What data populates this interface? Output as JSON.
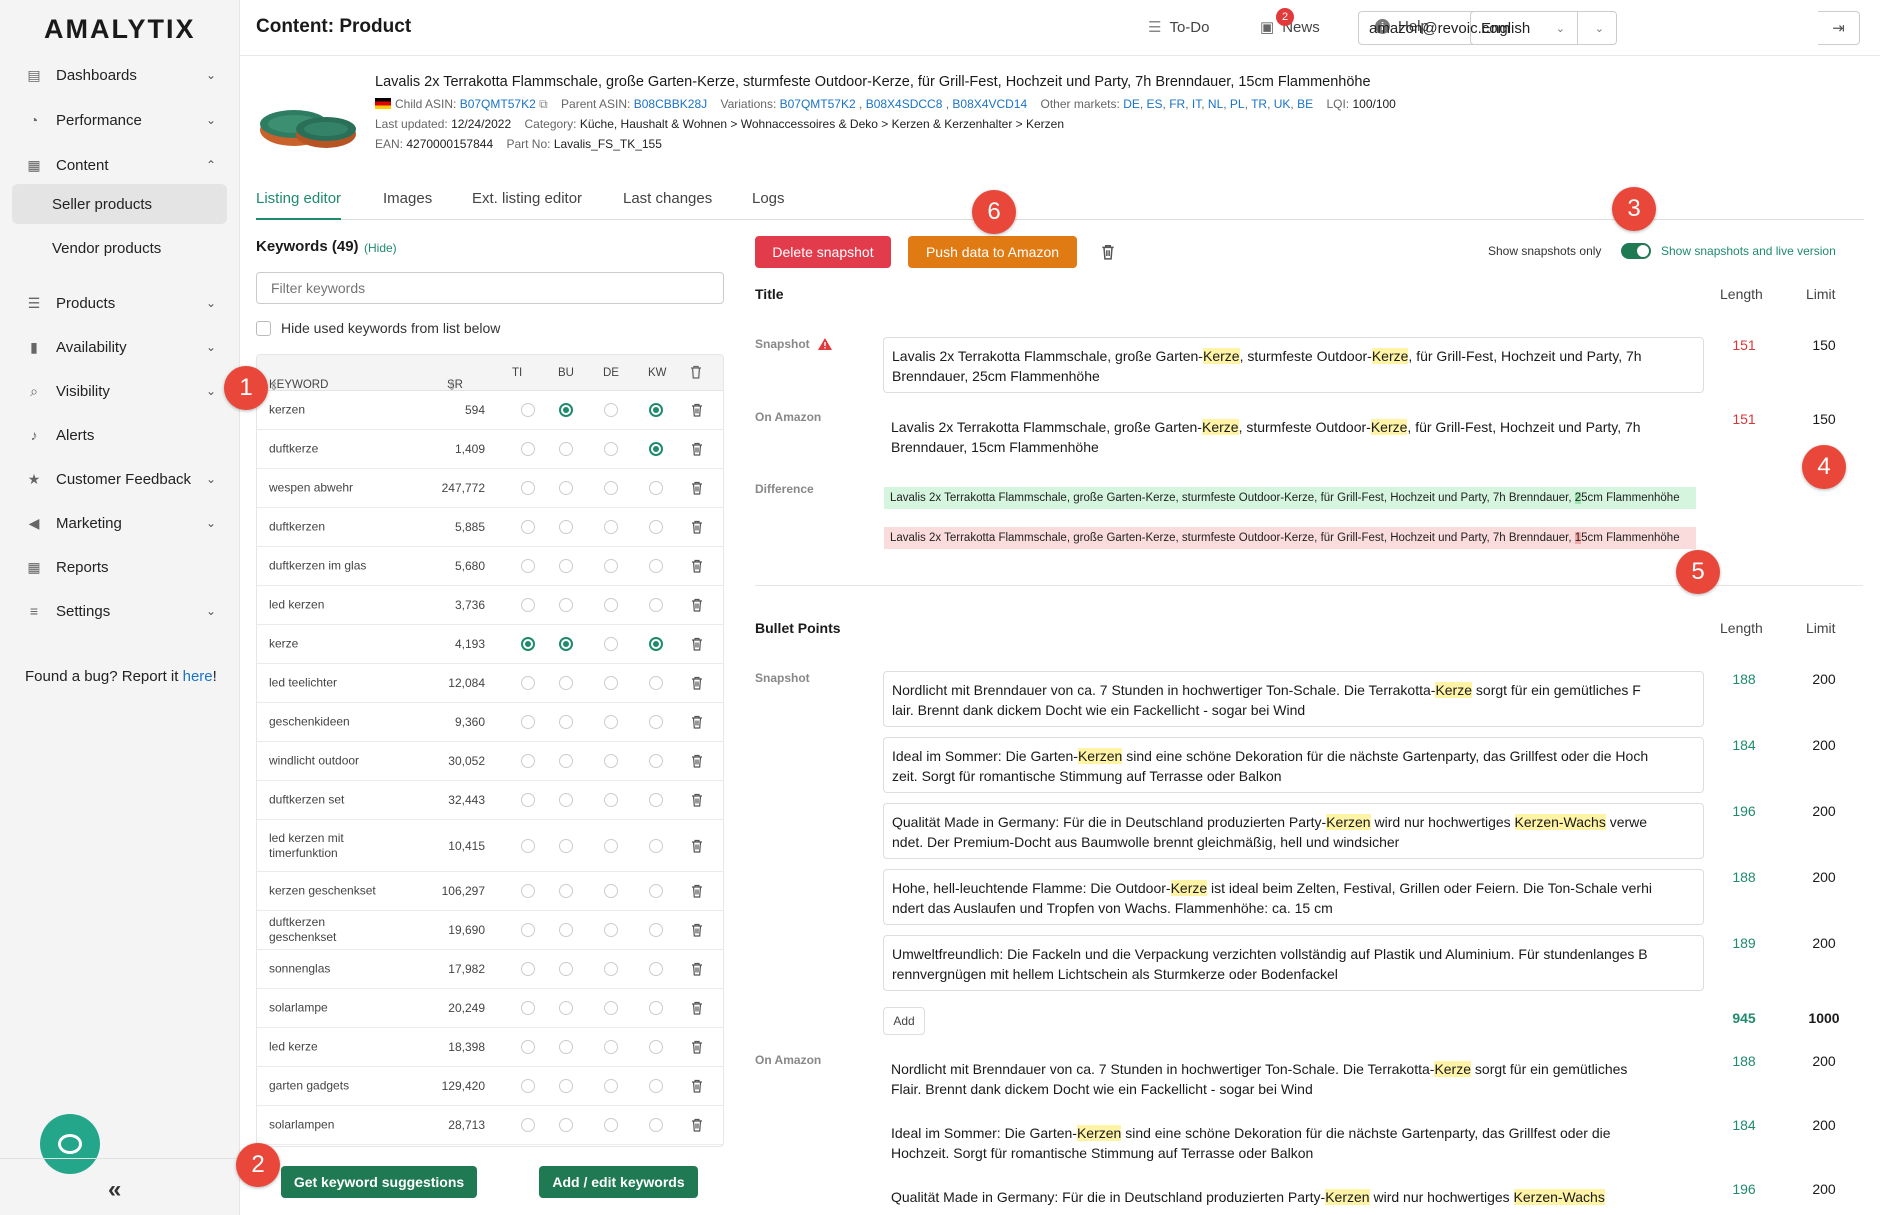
{
  "app": {
    "logo": "AMALYTIX"
  },
  "sidebar": {
    "items": [
      {
        "label": "Dashboards",
        "icon": "dashboard-icon"
      },
      {
        "label": "Performance",
        "icon": "gauge-icon"
      },
      {
        "label": "Content",
        "icon": "content-icon"
      },
      {
        "label": "Products",
        "icon": "list-icon"
      },
      {
        "label": "Availability",
        "icon": "thermometer-icon"
      },
      {
        "label": "Visibility",
        "icon": "search-icon"
      },
      {
        "label": "Alerts",
        "icon": "bell-icon"
      },
      {
        "label": "Customer Feedback",
        "icon": "star-icon"
      },
      {
        "label": "Marketing",
        "icon": "megaphone-icon"
      },
      {
        "label": "Reports",
        "icon": "table-icon"
      },
      {
        "label": "Settings",
        "icon": "sliders-icon"
      }
    ],
    "sub_items": [
      "Seller products",
      "Vendor products"
    ],
    "bug_text": "Found a bug? Report it ",
    "bug_link": "here",
    "bug_end": "!"
  },
  "topbar": {
    "title": "Content: Product",
    "todo": "To-Do",
    "news": "News",
    "news_count": "2",
    "help": "Help",
    "language": "English",
    "account": "amazon@revoic.com"
  },
  "product": {
    "title": "Lavalis 2x Terrakotta Flammschale, große Garten-Kerze, sturmfeste Outdoor-Kerze, für Grill-Fest, Hochzeit und Party, 7h Brenndauer, 15cm Flammenhöhe",
    "child_asin_label": "Child ASIN:",
    "child_asin": "B07QMT57K2",
    "parent_asin_label": "Parent ASIN:",
    "parent_asin": "B08CBBK28J",
    "variations_label": "Variations:",
    "variations": [
      "B07QMT57K2",
      "B08X4SDCC8",
      "B08X4VCD14"
    ],
    "other_markets_label": "Other markets:",
    "other_markets": [
      "DE",
      "ES",
      "FR",
      "IT",
      "NL",
      "PL",
      "TR",
      "UK",
      "BE"
    ],
    "lqi_label": "LQI:",
    "lqi": "100/100",
    "last_updated_label": "Last updated:",
    "last_updated": "12/24/2022",
    "category_label": "Category:",
    "category": "Küche, Haushalt & Wohnen > Wohnaccessoires & Deko > Kerzen & Kerzenhalter > Kerzen",
    "ean_label": "EAN:",
    "ean": "4270000157844",
    "partno_label": "Part No:",
    "partno": "Lavalis_FS_TK_155"
  },
  "tabs": [
    "Listing editor",
    "Images",
    "Ext. listing editor",
    "Last changes",
    "Logs"
  ],
  "keywords": {
    "heading": "Keywords (49)",
    "hide": "(Hide)",
    "filter_placeholder": "Filter keywords",
    "hide_used_label": "Hide used keywords from list below",
    "columns": [
      "KEYWORD",
      "SR",
      "TI",
      "BU",
      "DE",
      "KW"
    ],
    "rows": [
      {
        "k": "kerzen",
        "sr": "594",
        "ti": false,
        "bu": true,
        "de": false,
        "kw": true
      },
      {
        "k": "duftkerze",
        "sr": "1,409",
        "ti": false,
        "bu": false,
        "de": false,
        "kw": true
      },
      {
        "k": "wespen abwehr",
        "sr": "247,772",
        "ti": false,
        "bu": false,
        "de": false,
        "kw": false
      },
      {
        "k": "duftkerzen",
        "sr": "5,885",
        "ti": false,
        "bu": false,
        "de": false,
        "kw": false
      },
      {
        "k": "duftkerzen im glas",
        "sr": "5,680",
        "ti": false,
        "bu": false,
        "de": false,
        "kw": false
      },
      {
        "k": "led kerzen",
        "sr": "3,736",
        "ti": false,
        "bu": false,
        "de": false,
        "kw": false
      },
      {
        "k": "kerze",
        "sr": "4,193",
        "ti": true,
        "bu": true,
        "de": false,
        "kw": true
      },
      {
        "k": "led teelichter",
        "sr": "12,084",
        "ti": false,
        "bu": false,
        "de": false,
        "kw": false
      },
      {
        "k": "geschenkideen",
        "sr": "9,360",
        "ti": false,
        "bu": false,
        "de": false,
        "kw": false
      },
      {
        "k": "windlicht outdoor",
        "sr": "30,052",
        "ti": false,
        "bu": false,
        "de": false,
        "kw": false
      },
      {
        "k": "duftkerzen set",
        "sr": "32,443",
        "ti": false,
        "bu": false,
        "de": false,
        "kw": false
      },
      {
        "k": "led kerzen mit timerfunktion",
        "sr": "10,415",
        "ti": false,
        "bu": false,
        "de": false,
        "kw": false
      },
      {
        "k": "kerzen geschenkset",
        "sr": "106,297",
        "ti": false,
        "bu": false,
        "de": false,
        "kw": false
      },
      {
        "k": "duftkerzen geschenkset",
        "sr": "19,690",
        "ti": false,
        "bu": false,
        "de": false,
        "kw": false
      },
      {
        "k": "sonnenglas",
        "sr": "17,982",
        "ti": false,
        "bu": false,
        "de": false,
        "kw": false
      },
      {
        "k": "solarlampe",
        "sr": "20,249",
        "ti": false,
        "bu": false,
        "de": false,
        "kw": false
      },
      {
        "k": "led kerze",
        "sr": "18,398",
        "ti": false,
        "bu": false,
        "de": false,
        "kw": false
      },
      {
        "k": "garten gadgets",
        "sr": "129,420",
        "ti": false,
        "bu": false,
        "de": false,
        "kw": false
      },
      {
        "k": "solarlampen",
        "sr": "28,713",
        "ti": false,
        "bu": false,
        "de": false,
        "kw": false
      }
    ],
    "suggest_button": "Get keyword suggestions",
    "edit_button": "Add / edit keywords"
  },
  "actions": {
    "delete_snapshot": "Delete snapshot",
    "push_data": "Push data to Amazon",
    "toggle_left": "Show snapshots only",
    "toggle_right": "Show snapshots and live version"
  },
  "title_section": {
    "heading": "Title",
    "length_label": "Length",
    "limit_label": "Limit",
    "snapshot_label": "Snapshot",
    "on_amazon_label": "On Amazon",
    "difference_label": "Difference",
    "snapshot_pre": "Lavalis 2x Terrakotta Flammschale, große Garten-",
    "snapshot_mid": ", sturmfeste Outdoor-",
    "snapshot_post": ", für Grill-Fest, Hochzeit und Party, 7h Brenndauer, 25cm Flammenhöhe",
    "amazon_post": ", für Grill-Fest, Hochzeit und Party, 7h Brenndauer, 15cm Flammenhöhe",
    "kw": "Kerze",
    "snapshot_length": "151",
    "snapshot_limit": "150",
    "amazon_length": "151",
    "amazon_limit": "150",
    "diff_pre": "Lavalis 2x Terrakotta Flammschale, große Garten-Kerze, sturmfeste Outdoor-Kerze, für Grill-Fest, Hochzeit und Party, 7h Brenndauer, ",
    "diff_green_char": "2",
    "diff_red_char": "1",
    "diff_post": "5cm Flammenhöhe"
  },
  "bullets": {
    "heading": "Bullet Points",
    "length_label": "Length",
    "limit_label": "Limit",
    "snapshot_label": "Snapshot",
    "on_amazon_label": "On Amazon",
    "add_label": "Add",
    "total_length": "945",
    "total_limit": "1000",
    "snapshot": [
      {
        "length": "188",
        "limit": "200"
      },
      {
        "length": "184",
        "limit": "200"
      },
      {
        "length": "196",
        "limit": "200"
      },
      {
        "length": "188",
        "limit": "200"
      },
      {
        "length": "189",
        "limit": "200"
      }
    ],
    "amazon": [
      {
        "length": "188",
        "limit": "200"
      },
      {
        "length": "184",
        "limit": "200"
      },
      {
        "length": "196",
        "limit": "200"
      }
    ],
    "b1_pre": "Nordlicht mit Brenndauer von ca. 7 Stunden in hochwertiger Ton-Schale. Die Terrakotta-",
    "b1_kw": "Kerze",
    "b1_post": " sorgt für ein gemütliches F",
    "b1_line2": "lair. Brennt dank dickem Docht wie ein Fackellicht - sogar bei Wind",
    "b2_pre": "Ideal im Sommer: Die Garten-",
    "b2_kw": "Kerzen",
    "b2_post": " sind eine schöne Dekoration für die nächste Gartenparty, das Grillfest oder die Hoch",
    "b2_line2": "zeit. Sorgt für romantische Stimmung auf Terrasse oder Balkon",
    "b3_pre": "Qualität Made in Germany: Für die in Deutschland produzierten Party-",
    "b3_kw": "Kerzen",
    "b3_mid": " wird nur hochwertiges ",
    "b3_kw2": "Kerzen-Wachs",
    "b3_post": " verwe",
    "b3_line2": "ndet. Der Premium-Docht aus Baumwolle brennt gleichmäßig, hell und windsicher",
    "b4_pre": "Hohe, hell-leuchtende Flamme: Die Outdoor-",
    "b4_kw": "Kerze",
    "b4_post": " ist ideal beim Zelten, Festival, Grillen oder Feiern. Die Ton-Schale verhi",
    "b4_line2": "ndert das Auslaufen und Tropfen von Wachs. Flammenhöhe: ca. 15 cm",
    "b5_line1": "Umweltfreundlich: Die Fackeln und die Verpackung verzichten vollständig auf Plastik und Aluminium. Für stundenlanges B",
    "b5_line2": "rennvergnügen mit hellem Lichtschein als Sturmkerze oder Bodenfackel",
    "a1_post": " sorgt für ein gemütliches",
    "a1_line2": "Flair. Brennt dank dickem Docht wie ein Fackellicht - sogar bei Wind",
    "a2_post": " sind eine schöne Dekoration für die nächste Gartenparty, das Grillfest oder die",
    "a2_line2": "Hochzeit. Sorgt für romantische Stimmung auf Terrasse oder Balkon",
    "a3_kw2": "Kerzen-Wachs"
  },
  "callouts": [
    "1",
    "2",
    "3",
    "4",
    "5",
    "6"
  ],
  "colors": {
    "accent": "#1f8a6e",
    "danger": "#e23b4c",
    "orange": "#e07a12",
    "callout": "#e8473a"
  }
}
